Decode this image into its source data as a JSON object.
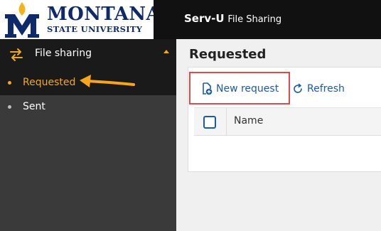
{
  "logo": {
    "line1": "MONTANA",
    "line2": "STATE UNIVERSITY"
  },
  "app": {
    "title_bold": "Serv-U",
    "title_rest": "File Sharing"
  },
  "sidebar": {
    "section_label": "File sharing",
    "items": [
      {
        "label": "Requested",
        "active": true
      },
      {
        "label": "Sent",
        "active": false
      }
    ]
  },
  "main": {
    "title": "Requested",
    "toolbar": {
      "new_request": "New request",
      "refresh": "Refresh"
    },
    "table": {
      "columns": [
        "Name"
      ]
    }
  },
  "colors": {
    "accent": "#f7a51c",
    "link": "#1c5aa6",
    "highlight_border": "#e04a4a",
    "msu_blue": "#0f2a6b",
    "msu_gold": "#f2b31b"
  },
  "icons": {
    "logo": "msu-m-logo",
    "section": "swap-arrows-icon",
    "new_request": "new-file-request-icon",
    "refresh": "refresh-icon"
  }
}
